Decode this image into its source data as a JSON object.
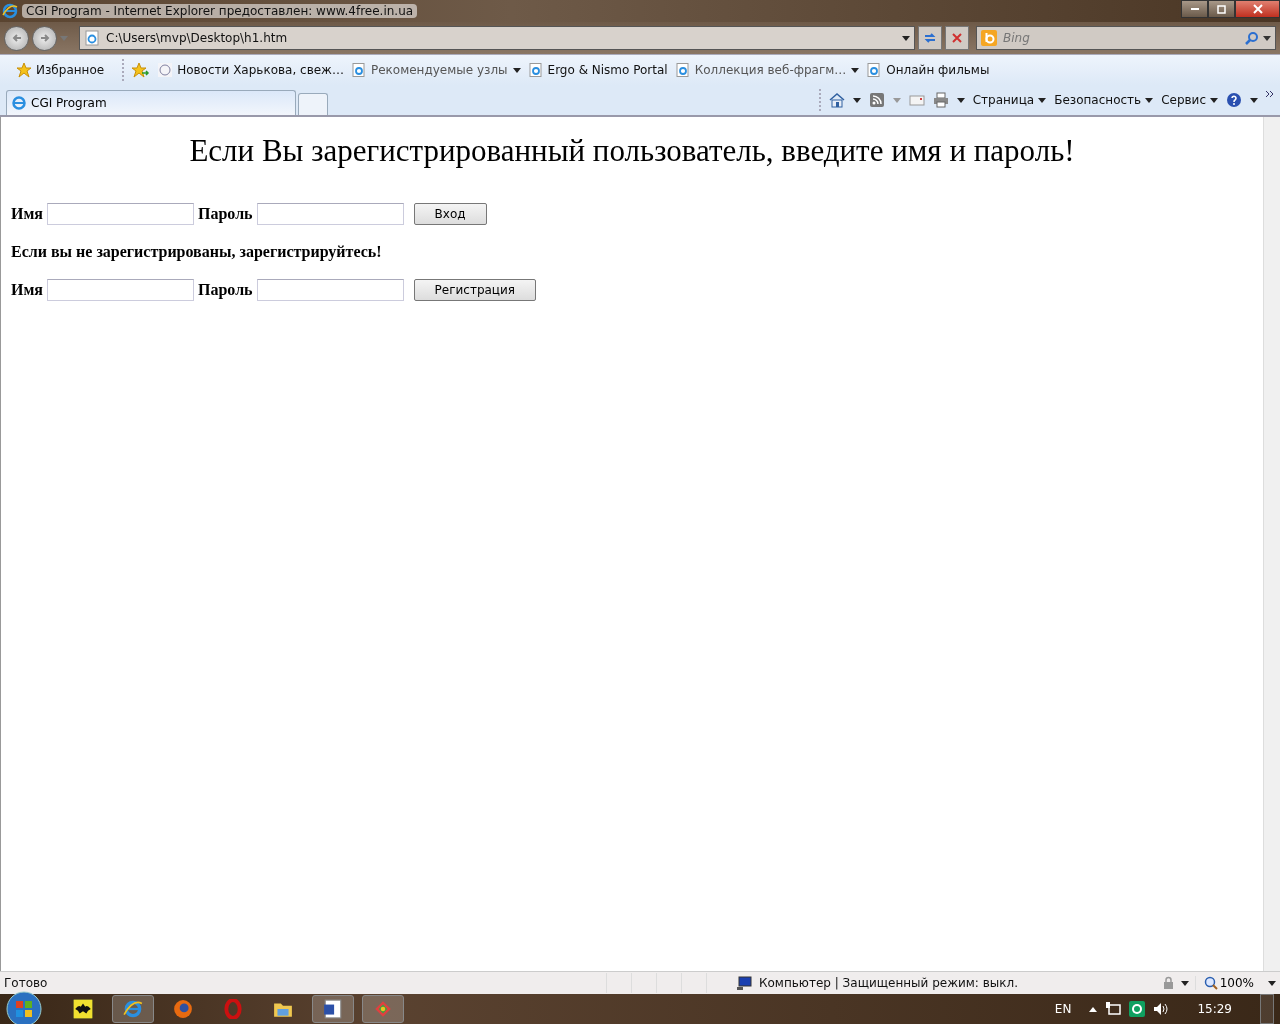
{
  "window": {
    "title": "CGI Program - Internet Explorer предоставлен: www.4free.in.ua"
  },
  "address_bar": {
    "value": "C:\\Users\\mvp\\Desktop\\h1.htm"
  },
  "search": {
    "placeholder": "Bing"
  },
  "favorites_bar": {
    "favorites_button": "Избранное",
    "links": [
      {
        "label": "Новости Харькова, свеж…",
        "kind": "site"
      },
      {
        "label": "Рекомендуемые узлы",
        "kind": "folder"
      },
      {
        "label": "Ergo & Nismo Portal",
        "kind": "page"
      },
      {
        "label": "Коллекция веб-фрагм…",
        "kind": "folder"
      },
      {
        "label": "Онлайн фильмы",
        "kind": "page"
      }
    ]
  },
  "tabs": [
    {
      "label": "CGI Program",
      "selected": true
    }
  ],
  "command_bar": {
    "menus": [
      "Страница",
      "Безопасность",
      "Сервис"
    ]
  },
  "page": {
    "heading": "Если Вы зарегистрированный пользователь, введите имя и пароль!",
    "login_form": {
      "name_label": "Имя",
      "password_label": "Пароль",
      "button": "Вход"
    },
    "register_prompt": "Если вы не зарегистрированы, зарегистрируйтесь!",
    "register_form": {
      "name_label": "Имя",
      "password_label": "Пароль",
      "button": "Регистрация"
    }
  },
  "status_bar": {
    "status": "Готово",
    "zone": "Компьютер | Защищенный режим: выкл.",
    "zoom": "100%"
  },
  "taskbar": {
    "apps": [
      {
        "kind": "batman",
        "running": false
      },
      {
        "kind": "ie",
        "running": true
      },
      {
        "kind": "firefox",
        "running": false
      },
      {
        "kind": "opera",
        "running": false
      },
      {
        "kind": "folder",
        "running": false
      },
      {
        "kind": "word",
        "running": true
      },
      {
        "kind": "tool",
        "running": true
      }
    ],
    "language": "EN",
    "clock": "15:29"
  }
}
